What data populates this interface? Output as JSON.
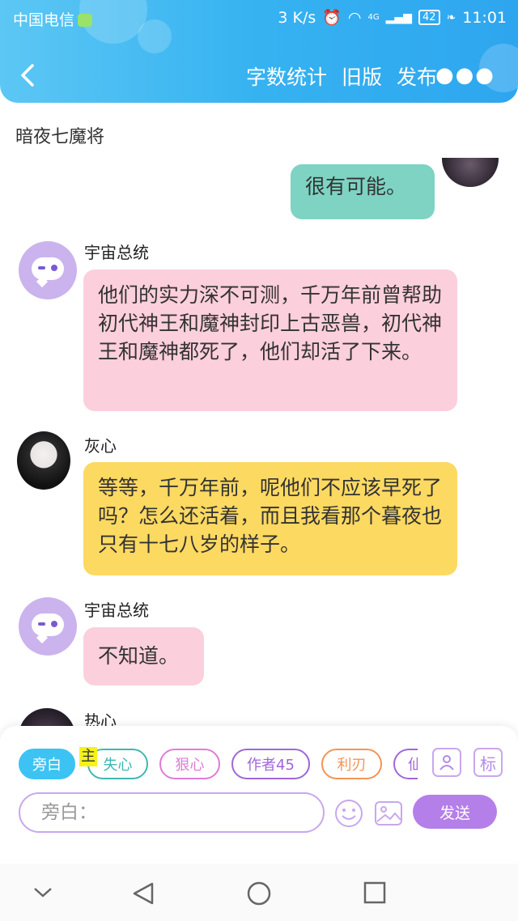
{
  "status": {
    "carrier": "中国电信",
    "speed": "3 K/s",
    "network": "4G",
    "battery": "42",
    "time": "11:01"
  },
  "nav": {
    "back_icon": "chevron-left-icon",
    "word_count": "字数统计",
    "old_version": "旧版",
    "publish": "发布",
    "more_icon": "more-dots-icon"
  },
  "story_title": "暗夜七魔将",
  "messages": [
    {
      "sender": "",
      "text": "很有可能。",
      "color": "#7ed3c3"
    },
    {
      "sender": "宇宙总统",
      "text": "他们的实力深不可测，千万年前曾帮助初代神王和魔神封印上古恶兽，初代神王和魔神都死了，他们却活了下来。",
      "color": "#fccfdc"
    },
    {
      "sender": "灰心",
      "text": "等等，千万年前，呢他们不应该早死了吗？怎么还活着，而且我看那个暮夜也只有十七八岁的样子。",
      "color": "#fcd961"
    },
    {
      "sender": "宇宙总统",
      "text": "不知道。",
      "color": "#fccfdc"
    },
    {
      "sender": "热心",
      "text": "",
      "color": "#fccfdc"
    }
  ],
  "roles": [
    {
      "label": "旁白",
      "color": "#2ec1f4",
      "selected": true
    },
    {
      "label": "失心",
      "color": "#3fb8b0"
    },
    {
      "label": "狠心",
      "color": "#e07bd8"
    },
    {
      "label": "作者45",
      "color": "#a067d8"
    },
    {
      "label": "利刃",
      "color": "#f39457"
    },
    {
      "label": "仙",
      "color": "#a067d8"
    }
  ],
  "role_badge": "主",
  "tools": {
    "person_icon": "person-card-icon",
    "tag_label": "标"
  },
  "input": {
    "placeholder": "旁白："
  },
  "emoji_icon": "smiley-icon",
  "image_icon": "image-icon",
  "send_label": "发送",
  "system_nav": [
    "chevron-down-icon",
    "back-triangle-icon",
    "home-circle-icon",
    "recents-square-icon"
  ]
}
